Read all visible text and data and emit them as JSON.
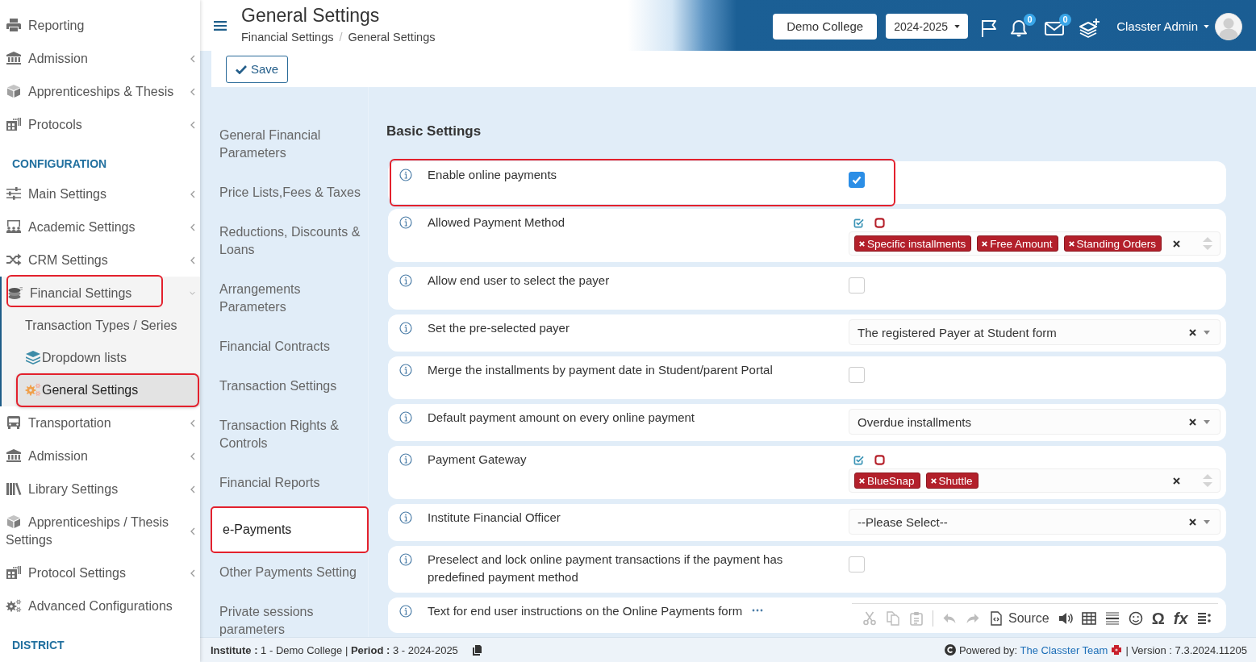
{
  "sidebar": {
    "items": [
      {
        "kind": "link",
        "label": "Reporting",
        "highlighted": false
      },
      {
        "kind": "menu",
        "label": "Admission",
        "expanded": false,
        "highlighted": false
      },
      {
        "kind": "menu",
        "label": "Apprenticeships & Thesis",
        "expanded": false,
        "highlighted": false
      },
      {
        "kind": "menu",
        "label": "Protocols",
        "expanded": false,
        "highlighted": false
      },
      {
        "kind": "section",
        "label": "CONFIGURATION"
      },
      {
        "kind": "menu",
        "label": "Main Settings",
        "expanded": false,
        "highlighted": false
      },
      {
        "kind": "menu",
        "label": "Academic Settings",
        "expanded": false,
        "highlighted": false
      },
      {
        "kind": "menu",
        "label": "CRM Settings",
        "expanded": false,
        "highlighted": false
      },
      {
        "kind": "menu",
        "label": "Financial Settings",
        "expanded": true,
        "highlighted": true,
        "children": [
          {
            "label": "Transaction Types / Series",
            "selected": false,
            "highlighted": false
          },
          {
            "label": "Dropdown lists",
            "selected": false,
            "highlighted": false
          },
          {
            "label": "General Settings",
            "selected": true,
            "highlighted": true
          }
        ]
      },
      {
        "kind": "menu",
        "label": "Transportation",
        "expanded": false,
        "highlighted": false
      },
      {
        "kind": "menu",
        "label": "Admission",
        "expanded": false,
        "highlighted": false
      },
      {
        "kind": "menu",
        "label": "Library Settings",
        "expanded": false,
        "highlighted": false
      },
      {
        "kind": "menu",
        "label": "Apprenticeships / Thesis Settings",
        "expanded": false,
        "highlighted": false
      },
      {
        "kind": "menu",
        "label": "Protocol Settings",
        "expanded": false,
        "highlighted": false
      },
      {
        "kind": "link",
        "label": "Advanced Configurations",
        "highlighted": false
      },
      {
        "kind": "section",
        "label": "DISTRICT"
      }
    ]
  },
  "header": {
    "title": "General Settings",
    "breadcrumb": [
      "Financial Settings",
      "General Settings"
    ],
    "breadcrumb_separator": "/",
    "institution_button": "Demo College",
    "year_dropdown": "2024-2025",
    "notifications_badge": "0",
    "messages_badge": "0",
    "user_name": "Classter Admin"
  },
  "toolbar": {
    "save_button": "Save"
  },
  "settings_nav": [
    {
      "label": "General Financial Parameters",
      "selected": false,
      "highlighted": false
    },
    {
      "label": "Price Lists,Fees & Taxes",
      "selected": false,
      "highlighted": false
    },
    {
      "label": "Reductions, Discounts & Loans",
      "selected": false,
      "highlighted": false
    },
    {
      "label": "Arrangements Parameters",
      "selected": false,
      "highlighted": false
    },
    {
      "label": "Financial Contracts",
      "selected": false,
      "highlighted": false
    },
    {
      "label": "Transaction Settings",
      "selected": false,
      "highlighted": false
    },
    {
      "label": "Transaction Rights & Controls",
      "selected": false,
      "highlighted": false
    },
    {
      "label": "Financial Reports",
      "selected": false,
      "highlighted": false
    },
    {
      "label": "e-Payments",
      "selected": true,
      "highlighted": true
    },
    {
      "label": "Other Payments Setting",
      "selected": false,
      "highlighted": false
    },
    {
      "label": "Private sessions parameters",
      "selected": false,
      "highlighted": false
    }
  ],
  "basic_settings": {
    "title": "Basic Settings",
    "rows": [
      {
        "kind": "checkbox",
        "label": "Enable online payments",
        "checked": true,
        "highlighted": true
      },
      {
        "kind": "multiselect",
        "label": "Allowed Payment Method",
        "tags": [
          "Specific installments",
          "Free Amount",
          "Standing Orders"
        ],
        "highlighted": false
      },
      {
        "kind": "checkbox",
        "label": "Allow end user to select the payer",
        "checked": false,
        "highlighted": false
      },
      {
        "kind": "select",
        "label": "Set the pre-selected payer",
        "value": "The registered Payer at Student form",
        "highlighted": false
      },
      {
        "kind": "checkbox",
        "label": "Merge the installments by payment date in Student/parent Portal",
        "checked": false,
        "highlighted": false
      },
      {
        "kind": "select",
        "label": "Default payment amount on every online payment",
        "value": "Overdue installments",
        "highlighted": false
      },
      {
        "kind": "multiselect",
        "label": "Payment Gateway",
        "tags": [
          "BlueSnap",
          "Shuttle"
        ],
        "highlighted": false
      },
      {
        "kind": "select",
        "label": "Institute Financial Officer",
        "value": "--Please Select--",
        "highlighted": false
      },
      {
        "kind": "checkbox",
        "label": "Preselect and lock online payment transactions if the payment has predefined payment method",
        "checked": false,
        "highlighted": false
      },
      {
        "kind": "editor",
        "label": "Text for end user instructions on the Online Payments form",
        "highlighted": false,
        "toolbar": [
          {
            "kind": "icon",
            "disabled": true
          },
          {
            "kind": "icon",
            "disabled": true
          },
          {
            "kind": "icon",
            "disabled": true
          },
          {
            "kind": "separator"
          },
          {
            "kind": "icon",
            "disabled": true
          },
          {
            "kind": "icon",
            "disabled": true
          },
          {
            "kind": "text",
            "label": "Source",
            "disabled": false
          },
          {
            "kind": "icon",
            "disabled": false
          },
          {
            "kind": "icon",
            "disabled": false
          },
          {
            "kind": "icon",
            "disabled": false
          },
          {
            "kind": "icon",
            "disabled": false
          },
          {
            "kind": "glyph",
            "label": "Ω",
            "disabled": false
          },
          {
            "kind": "glyph",
            "label": "fx",
            "disabled": false
          },
          {
            "kind": "icon",
            "disabled": false
          }
        ]
      }
    ]
  },
  "footer": {
    "context": "**Institute :** 1 - Demo College | **Period :** 3 - 2024-2025",
    "powered_by": "Powered by:",
    "team_link": "The Classter Team",
    "version": "| Version : 7.3.2024.11205"
  }
}
